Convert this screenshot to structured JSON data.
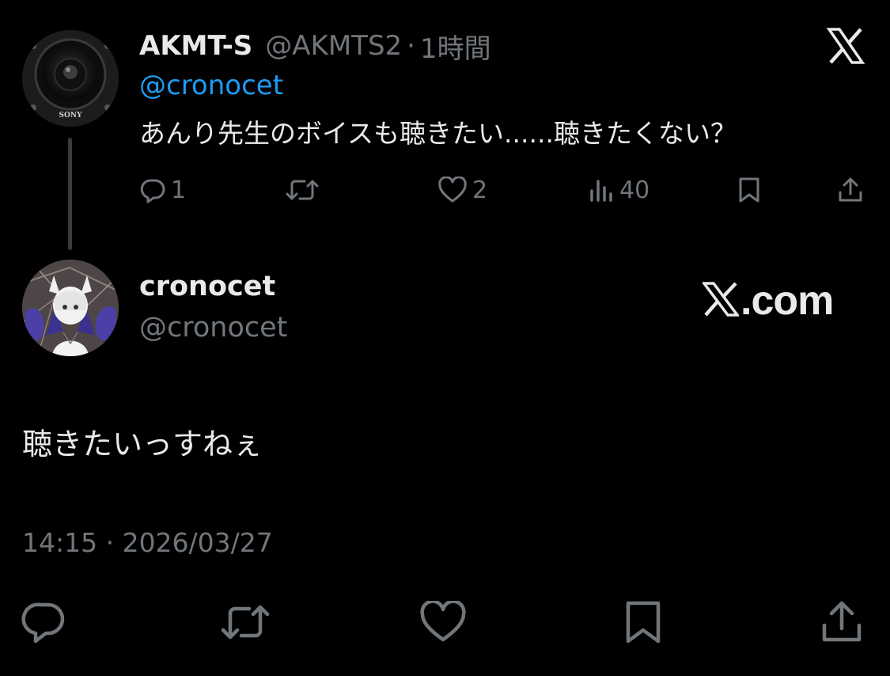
{
  "parent_tweet": {
    "author_name": "AKMT-S",
    "author_handle": "@AKMTS2",
    "separator": "·",
    "time_ago": "1時間",
    "reply_to": "@cronocet",
    "text": "あんり先生のボイスも聴きたい......聴きたくない？",
    "avatar_label": "SONY",
    "metrics": {
      "replies": "1",
      "reposts": "",
      "likes": "2",
      "views": "40"
    }
  },
  "reply_tweet": {
    "author_name": "cronocet",
    "author_handle": "@cronocet",
    "text": "聴きたいっすねぇ",
    "timestamp": "14:15 · 2026/03/27"
  },
  "brand": {
    "watermark": ".com"
  },
  "icons": {
    "top_right": "x-logo-icon",
    "small_actions": [
      "reply-icon",
      "repost-icon",
      "like-icon",
      "views-icon",
      "bookmark-icon",
      "share-icon"
    ],
    "big_actions": [
      "reply-icon",
      "repost-icon",
      "like-icon",
      "bookmark-icon",
      "share-icon"
    ]
  },
  "colors": {
    "background": "#000000",
    "text_primary": "#e7e9ea",
    "text_secondary": "#71767b",
    "link": "#1d9bf0"
  }
}
